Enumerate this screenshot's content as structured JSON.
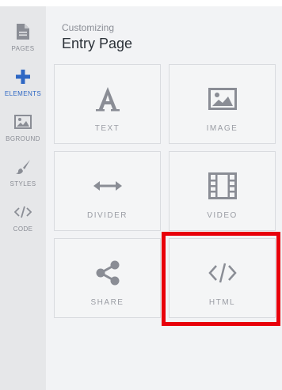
{
  "sidebar": {
    "items": [
      {
        "label": "PAGES",
        "icon": "document-icon"
      },
      {
        "label": "ELEMENTS",
        "icon": "plus-icon",
        "active": true
      },
      {
        "label": "BGROUND",
        "icon": "image-icon"
      },
      {
        "label": "STYLES",
        "icon": "brush-icon"
      },
      {
        "label": "CODE",
        "icon": "code-icon"
      }
    ]
  },
  "header": {
    "subtitle": "Customizing",
    "title": "Entry Page"
  },
  "elements": [
    {
      "label": "TEXT",
      "icon": "text-icon"
    },
    {
      "label": "IMAGE",
      "icon": "image-icon"
    },
    {
      "label": "DIVIDER",
      "icon": "horizontal-arrows-icon"
    },
    {
      "label": "VIDEO",
      "icon": "film-icon"
    },
    {
      "label": "SHARE",
      "icon": "share-icon"
    },
    {
      "label": "HTML",
      "icon": "code-icon",
      "highlighted": true
    }
  ],
  "colors": {
    "accent": "#2f68c4",
    "highlight": "#e8000b",
    "rail_bg": "#e6e7e9",
    "panel_bg": "#f2f3f5",
    "icon_gray": "#8a8d95"
  }
}
